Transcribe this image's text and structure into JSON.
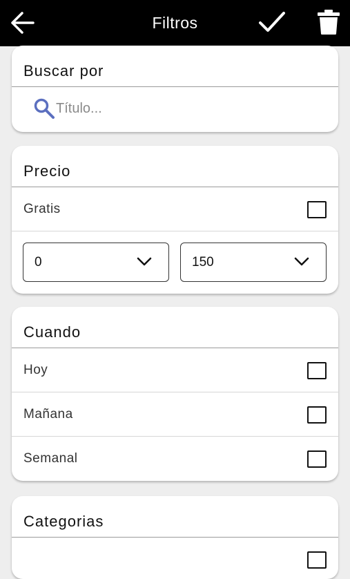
{
  "header": {
    "title": "Filtros"
  },
  "search": {
    "heading": "Buscar por",
    "placeholder": "Título..."
  },
  "price": {
    "heading": "Precio",
    "free_label": "Gratis",
    "min_value": "0",
    "max_value": "150"
  },
  "when": {
    "heading": "Cuando",
    "options": [
      "Hoy",
      "Mañana",
      "Semanal"
    ]
  },
  "categories": {
    "heading": "Categorias"
  },
  "colors": {
    "topbar": "#000000",
    "search_icon": "#5b6fbf",
    "background": "#eeeeee"
  }
}
